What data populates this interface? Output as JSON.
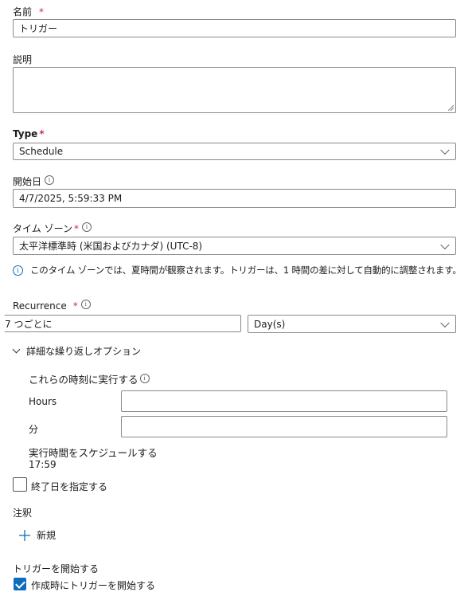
{
  "name": {
    "label": "名前",
    "required": "*",
    "value": "トリガー"
  },
  "description": {
    "label": "説明",
    "value": ""
  },
  "type": {
    "label": "Type",
    "required": "*",
    "value": "Schedule"
  },
  "start_date": {
    "label": "開始日",
    "value": "4/7/2025, 5:59:33 PM"
  },
  "timezone": {
    "label": "タイム ゾーン",
    "required": "*",
    "value": "太平洋標準時 (米国およびカナダ) (UTC-8)",
    "info_message": "このタイム ゾーンでは、夏時間が観察されます。トリガーは、1 時間の差に対して自動的に調整されます。"
  },
  "recurrence": {
    "label": "Recurrence",
    "required": "*",
    "interval_value": "7 つごとに",
    "unit_value": "Day(s)"
  },
  "advanced": {
    "toggle_label": "詳細な繰り返しオプション",
    "run_at_label": "これらの時刻に実行する",
    "hours_label": "Hours",
    "hours_value": "",
    "minutes_label": "分",
    "minutes_value": "",
    "schedule_label": "実行時間をスケジュールする",
    "schedule_value": "17:59"
  },
  "end_date": {
    "label": "終了日を指定する",
    "checked": false
  },
  "annotations": {
    "label": "注釈",
    "new_label": "新規"
  },
  "start_trigger": {
    "label": "トリガーを開始する",
    "checkbox_label": "作成時にトリガーを開始する",
    "checked": true
  },
  "colors": {
    "accent": "#0f6cbd",
    "required": "#c4314b",
    "border": "#8a8a8a"
  }
}
